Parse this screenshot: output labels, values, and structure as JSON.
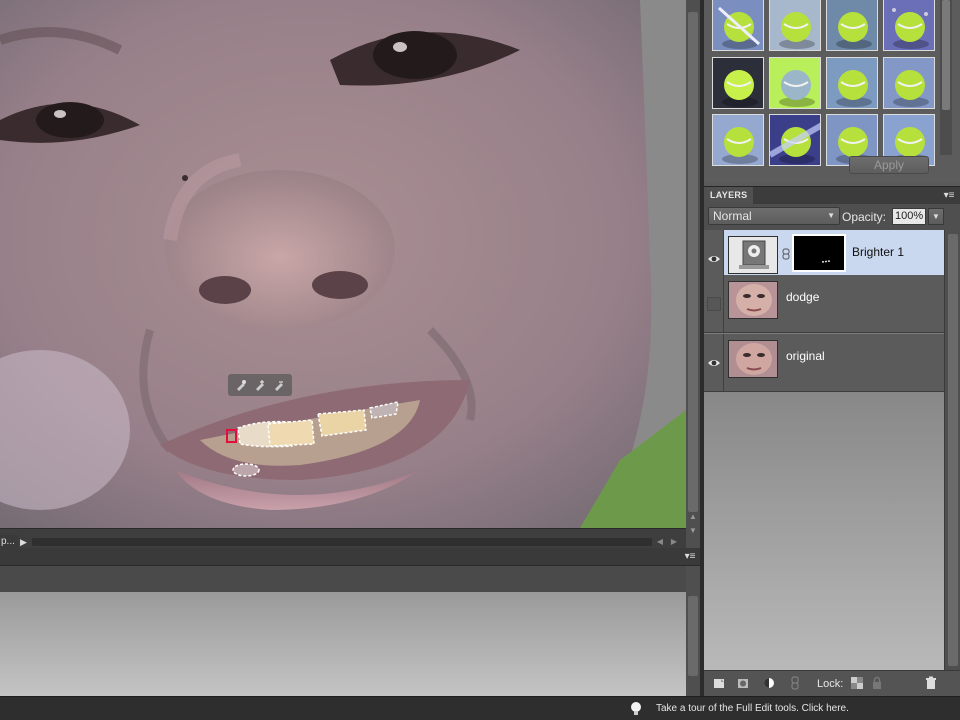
{
  "canvas": {
    "zoom_field": "p...",
    "status_arrow": "▶",
    "quick_select_tools": [
      "quick-selection-icon",
      "quick-selection-add-icon",
      "quick-selection-subtract-icon"
    ]
  },
  "effects_panel": {
    "apply_label": "Apply",
    "thumbnails": [
      "effect-1",
      "effect-2",
      "effect-3",
      "effect-4",
      "effect-5",
      "effect-6",
      "effect-7",
      "effect-8",
      "effect-9",
      "effect-10",
      "effect-11",
      "effect-12"
    ]
  },
  "layers_panel": {
    "tab_label": "LAYERS",
    "menu_glyph": "▾≡",
    "blend_mode": "Normal",
    "opacity_label": "Opacity:",
    "opacity_value": "100%",
    "layers": [
      {
        "name": "Brighter 1",
        "visible": true,
        "selected": true,
        "type": "adjustment"
      },
      {
        "name": "dodge",
        "visible": false,
        "selected": false,
        "type": "image"
      },
      {
        "name": "original",
        "visible": true,
        "selected": false,
        "type": "image"
      }
    ],
    "lock_label": "Lock:"
  },
  "bin": {
    "menu_glyph": "▾≡"
  },
  "tip_bar": {
    "text": "Take a tour of the Full Edit tools. Click here."
  },
  "colors": {
    "selected_layer": "#c9d8ef",
    "thumb_green": "#b6e03c",
    "panel_gray": "#5c5c5c"
  }
}
